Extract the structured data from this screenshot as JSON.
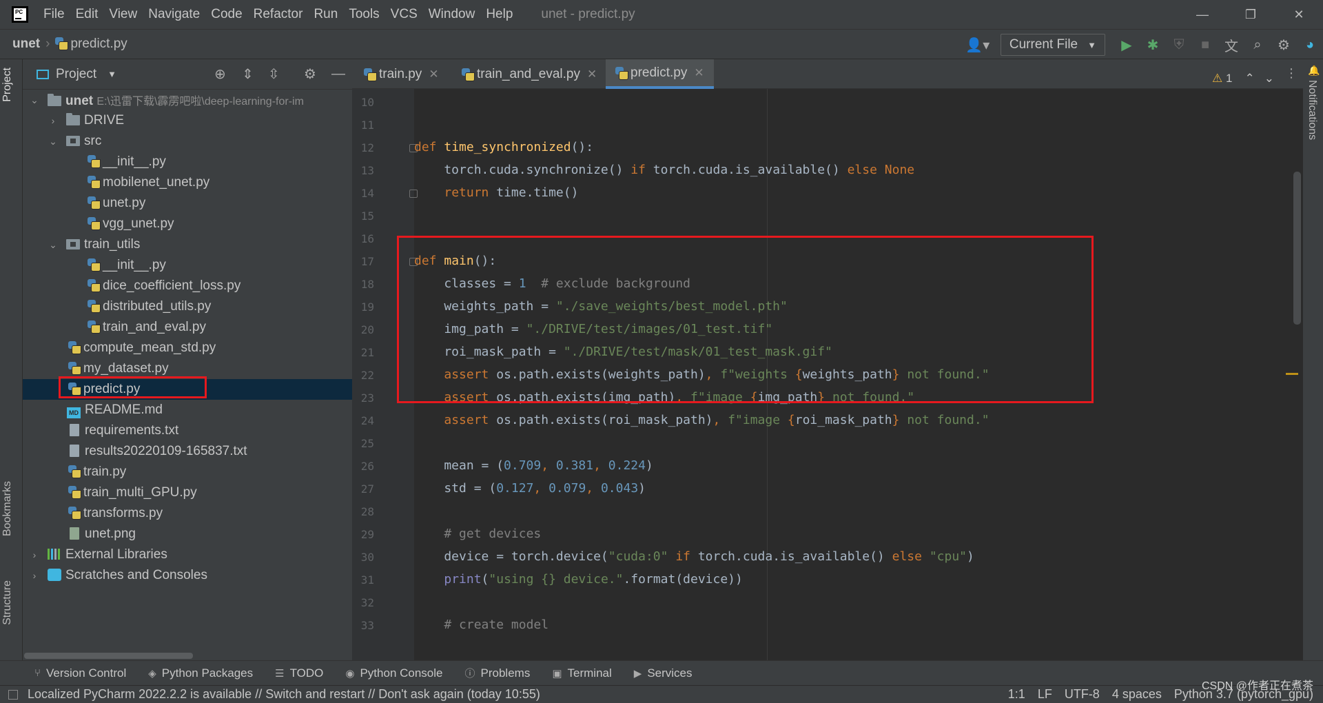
{
  "window": {
    "title": "unet - predict.py",
    "menu": [
      "File",
      "Edit",
      "View",
      "Navigate",
      "Code",
      "Refactor",
      "Run",
      "Tools",
      "VCS",
      "Window",
      "Help"
    ],
    "controls": {
      "minimize": "—",
      "restore": "❐",
      "close": "✕"
    }
  },
  "breadcrumb": {
    "project": "unet",
    "file": "predict.py"
  },
  "run_config": {
    "label": "Current File"
  },
  "left_tool_tabs": [
    "Project",
    "Bookmarks",
    "Structure"
  ],
  "right_tool_tabs": [
    "Notifications"
  ],
  "project_panel": {
    "title": "Project",
    "root": {
      "name": "unet",
      "path": "E:\\迅雷下载\\霹雳吧啦\\deep-learning-for-im"
    },
    "items": [
      {
        "label": "DRIVE",
        "type": "folder",
        "expanded": false
      },
      {
        "label": "src",
        "type": "source-folder",
        "expanded": true
      },
      {
        "label": "__init__.py",
        "type": "py"
      },
      {
        "label": "mobilenet_unet.py",
        "type": "py"
      },
      {
        "label": "unet.py",
        "type": "py"
      },
      {
        "label": "vgg_unet.py",
        "type": "py"
      },
      {
        "label": "train_utils",
        "type": "source-folder",
        "expanded": true
      },
      {
        "label": "__init__.py",
        "type": "py"
      },
      {
        "label": "dice_coefficient_loss.py",
        "type": "py"
      },
      {
        "label": "distributed_utils.py",
        "type": "py"
      },
      {
        "label": "train_and_eval.py",
        "type": "py"
      },
      {
        "label": "compute_mean_std.py",
        "type": "py"
      },
      {
        "label": "my_dataset.py",
        "type": "py"
      },
      {
        "label": "predict.py",
        "type": "py",
        "selected": true
      },
      {
        "label": "README.md",
        "type": "md"
      },
      {
        "label": "requirements.txt",
        "type": "txt"
      },
      {
        "label": "results20220109-165837.txt",
        "type": "txt"
      },
      {
        "label": "train.py",
        "type": "py"
      },
      {
        "label": "train_multi_GPU.py",
        "type": "py"
      },
      {
        "label": "transforms.py",
        "type": "py"
      },
      {
        "label": "unet.png",
        "type": "image"
      },
      {
        "label": "External Libraries",
        "type": "libraries",
        "expanded": false
      },
      {
        "label": "Scratches and Consoles",
        "type": "scratches",
        "expanded": false
      }
    ]
  },
  "editor_tabs": [
    {
      "label": "train.py",
      "active": false
    },
    {
      "label": "train_and_eval.py",
      "active": false
    },
    {
      "label": "predict.py",
      "active": true
    }
  ],
  "inspection": {
    "warnings": "1"
  },
  "code": {
    "line_numbers": [
      "10",
      "11",
      "12",
      "13",
      "14",
      "15",
      "16",
      "17",
      "18",
      "19",
      "20",
      "21",
      "22",
      "23",
      "24",
      "25",
      "26",
      "27",
      "28",
      "29",
      "30",
      "31",
      "32",
      "33"
    ],
    "lines": [
      "",
      "",
      "def time_synchronized():",
      "    torch.cuda.synchronize() if torch.cuda.is_available() else None",
      "    return time.time()",
      "",
      "",
      "def main():",
      "    classes = 1  # exclude background",
      "    weights_path = \"./save_weights/best_model.pth\"",
      "    img_path = \"./DRIVE/test/images/01_test.tif\"",
      "    roi_mask_path = \"./DRIVE/test/mask/01_test_mask.gif\"",
      "    assert os.path.exists(weights_path), f\"weights {weights_path} not found.\"",
      "    assert os.path.exists(img_path), f\"image {img_path} not found.\"",
      "    assert os.path.exists(roi_mask_path), f\"image {roi_mask_path} not found.\"",
      "",
      "    mean = (0.709, 0.381, 0.224)",
      "    std = (0.127, 0.079, 0.043)",
      "",
      "    # get devices",
      "    device = torch.device(\"cuda:0\" if torch.cuda.is_available() else \"cpu\")",
      "    print(\"using {} device.\".format(device))",
      "",
      "    # create model"
    ]
  },
  "bottom_tools": [
    "Version Control",
    "Python Packages",
    "TODO",
    "Python Console",
    "Problems",
    "Terminal",
    "Services"
  ],
  "status": {
    "message": "Localized PyCharm 2022.2.2 is available // Switch and restart // Don't ask again (today 10:55)",
    "position": "1:1",
    "line_sep": "LF",
    "encoding": "UTF-8",
    "indent": "4 spaces",
    "interpreter": "Python 3.7 (pytorch_gpu)",
    "watermark": "CSDN @作者正在煮茶"
  },
  "colors": {
    "highlight_box": "#e6191e",
    "selection": "#0d293e",
    "accent": "#4a88c7"
  }
}
